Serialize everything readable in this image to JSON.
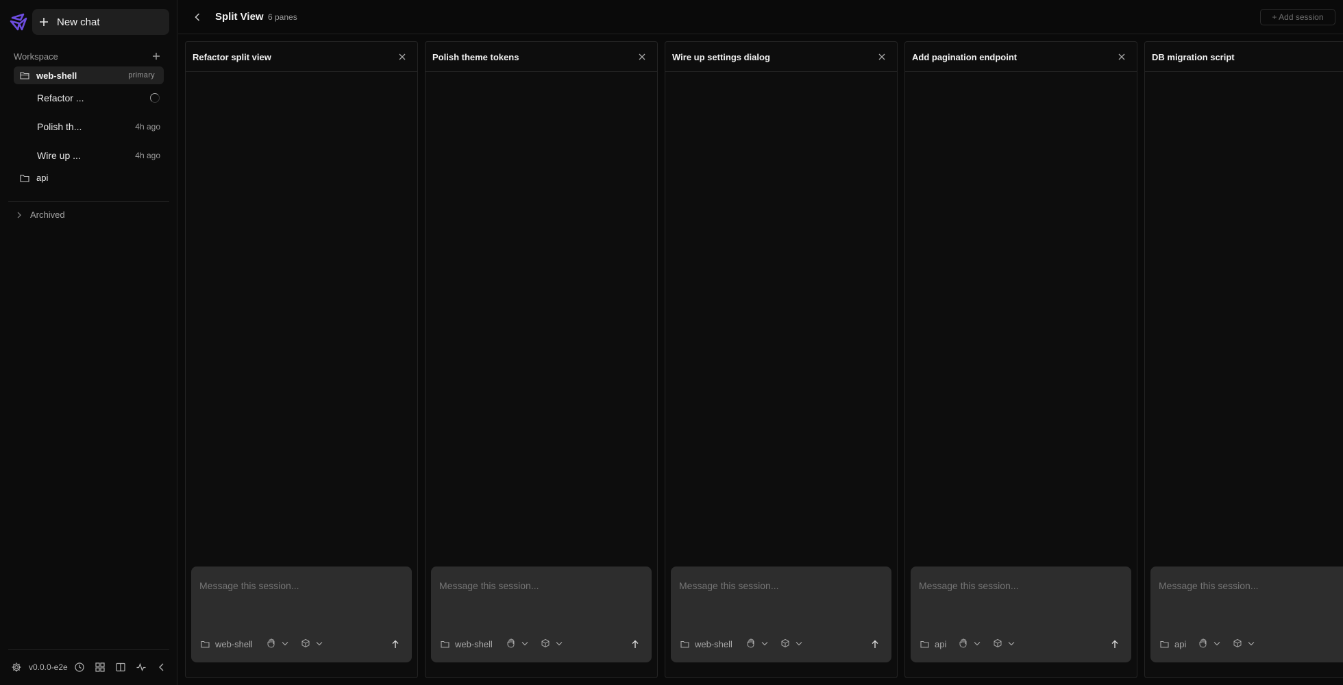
{
  "sidebar": {
    "new_chat_label": "New chat",
    "workspace_label": "Workspace",
    "active_project": {
      "name": "web-shell",
      "badge": "primary"
    },
    "sessions": [
      {
        "name": "Refactor ...",
        "time": "",
        "status": "loading"
      },
      {
        "name": "Polish th...",
        "time": "4h ago"
      },
      {
        "name": "Wire up ...",
        "time": "4h ago"
      }
    ],
    "other_project": "api",
    "archived_label": "Archived",
    "version": "v0.0.0-e2e"
  },
  "topbar": {
    "title": "Split View",
    "pane_count": "6 panes",
    "add_session_label": "+ Add session"
  },
  "panes": [
    {
      "title": "Refactor split view",
      "placeholder": "Message this session...",
      "project": "web-shell"
    },
    {
      "title": "Polish theme tokens",
      "placeholder": "Message this session...",
      "project": "web-shell"
    },
    {
      "title": "Wire up settings dialog",
      "placeholder": "Message this session...",
      "project": "web-shell"
    },
    {
      "title": "Add pagination endpoint",
      "placeholder": "Message this session...",
      "project": "api"
    },
    {
      "title": "DB migration script",
      "placeholder": "Message this session...",
      "project": "api"
    }
  ],
  "colors": {
    "accent": "#6d4de0",
    "background": "#0a0a0a",
    "panel": "#2d2d2d"
  }
}
